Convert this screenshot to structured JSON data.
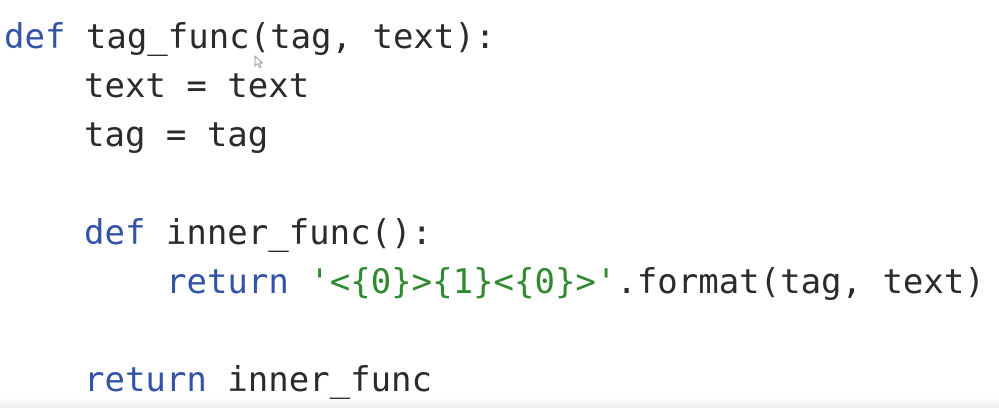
{
  "code": {
    "line1": {
      "kw": "def",
      "rest": " tag_func(tag, text):"
    },
    "line2": {
      "text": "text = text"
    },
    "line3": {
      "text": "tag = tag"
    },
    "line4": {
      "kw": "def",
      "rest": " inner_func():"
    },
    "line5": {
      "kw": "return",
      "sp": " ",
      "str": "'<{0}>{1}<{0}>'",
      "rest": ".format(tag, text)"
    },
    "line6": {
      "kw": "return",
      "rest": " inner_func"
    }
  },
  "colors": {
    "keyword": "#3353a6",
    "string": "#2f8a2f",
    "text": "#2b2b2b",
    "background": "#ffffff"
  },
  "icons": {
    "cursor": "mouse-pointer-icon"
  }
}
